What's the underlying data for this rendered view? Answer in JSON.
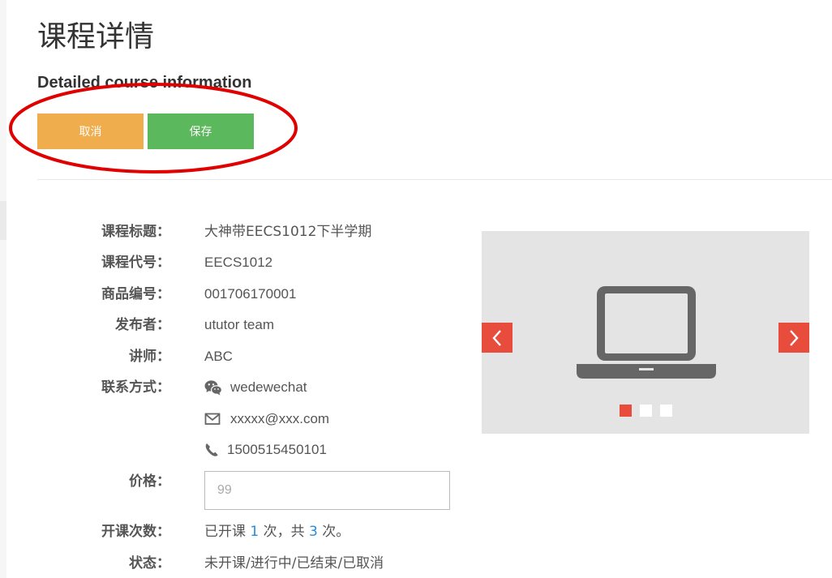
{
  "header": {
    "title": "课程详情",
    "subtitle": "Detailed course information"
  },
  "actions": {
    "cancel_label": "取消",
    "save_label": "保存"
  },
  "course": {
    "title_label": "课程标题：",
    "title_value": "大神带EECS1012下半学期",
    "code_label": "课程代号：",
    "code_value": "EECS1012",
    "product_label": "商品编号：",
    "product_value": "001706170001",
    "publisher_label": "发布者：",
    "publisher_value": "ututor team",
    "teacher_label": "讲师：",
    "teacher_value": "ABC",
    "contact_label": "联系方式：",
    "contact": {
      "wechat": "wedewechat",
      "email": "xxxxx@xxx.com",
      "phone": "1500515450101"
    },
    "price_label": "价格：",
    "price_placeholder": "99",
    "sessions_label": "开课次数：",
    "sessions_prefix": "已开课",
    "sessions_opened": "1",
    "sessions_middle": "次，共",
    "sessions_total": "3",
    "sessions_suffix": "次。",
    "status_label": "状态：",
    "status_value": "未开课/进行中/已结束/已取消"
  },
  "carousel": {
    "slide_icon": "laptop-icon",
    "slide_count": 3,
    "active_slide": 1
  },
  "colors": {
    "cancel": "#f0ad4e",
    "save": "#5cb85c",
    "accent": "#e74c3c",
    "link": "#2a8bd8",
    "annotation": "#e00000"
  }
}
